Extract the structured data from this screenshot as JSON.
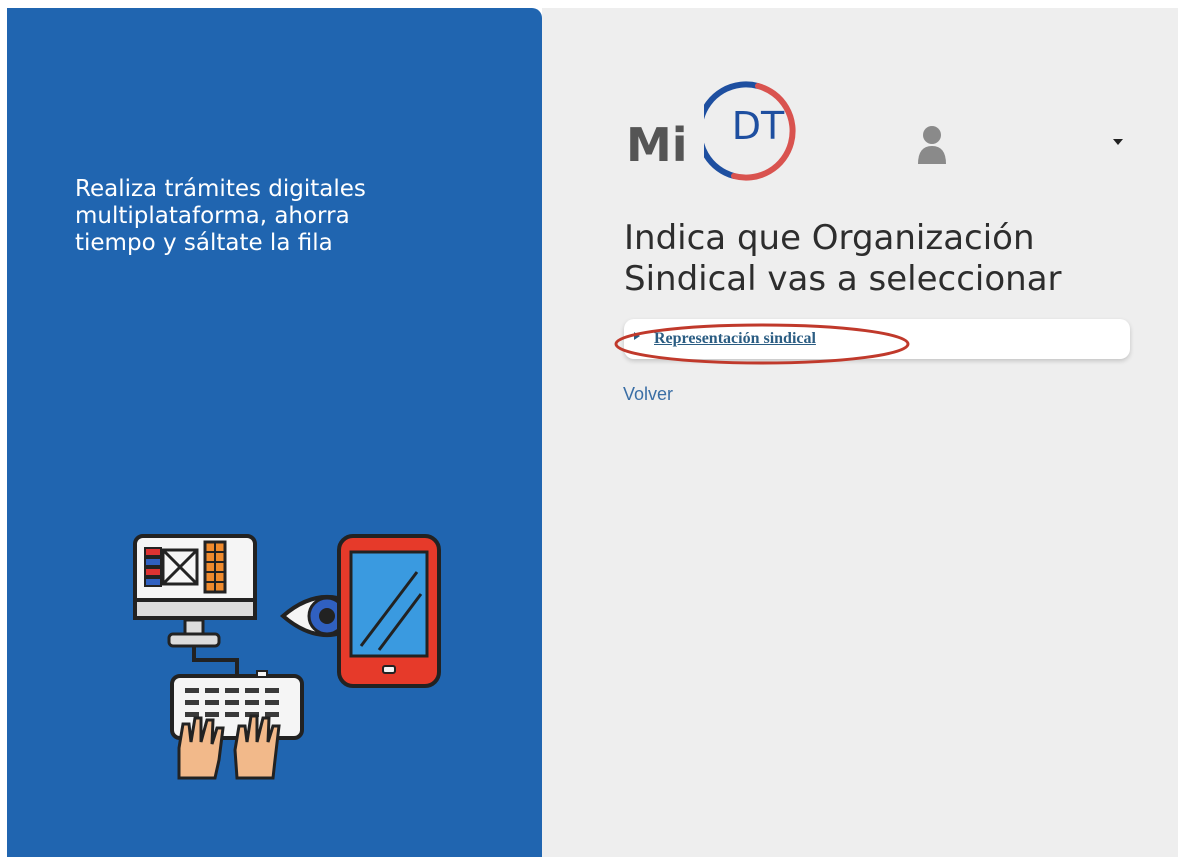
{
  "left_panel": {
    "tagline": "Realiza trámites digitales\nmultiplataforma, ahorra\ntiempo y sáltate la fila",
    "background_color": "#2065b0",
    "illustration_icon": "computer-tablet-eye-keyboard-illustration"
  },
  "header": {
    "logo": {
      "text_mi": "Mi",
      "text_dt": "DT",
      "ring_colors": [
        "#d9534f",
        "#1e4fa0"
      ]
    },
    "user_menu": {
      "user_icon": "user-icon",
      "dropdown_icon": "caret-down-icon"
    }
  },
  "main": {
    "heading": "Indica que Organización\nSindical vas a seleccionar",
    "options": [
      {
        "label": "Representación sindical",
        "toggle_icon": "caret-right-icon"
      }
    ],
    "back_label": "Volver",
    "highlight_color": "#c0392b",
    "background_color": "#eeeeee"
  }
}
